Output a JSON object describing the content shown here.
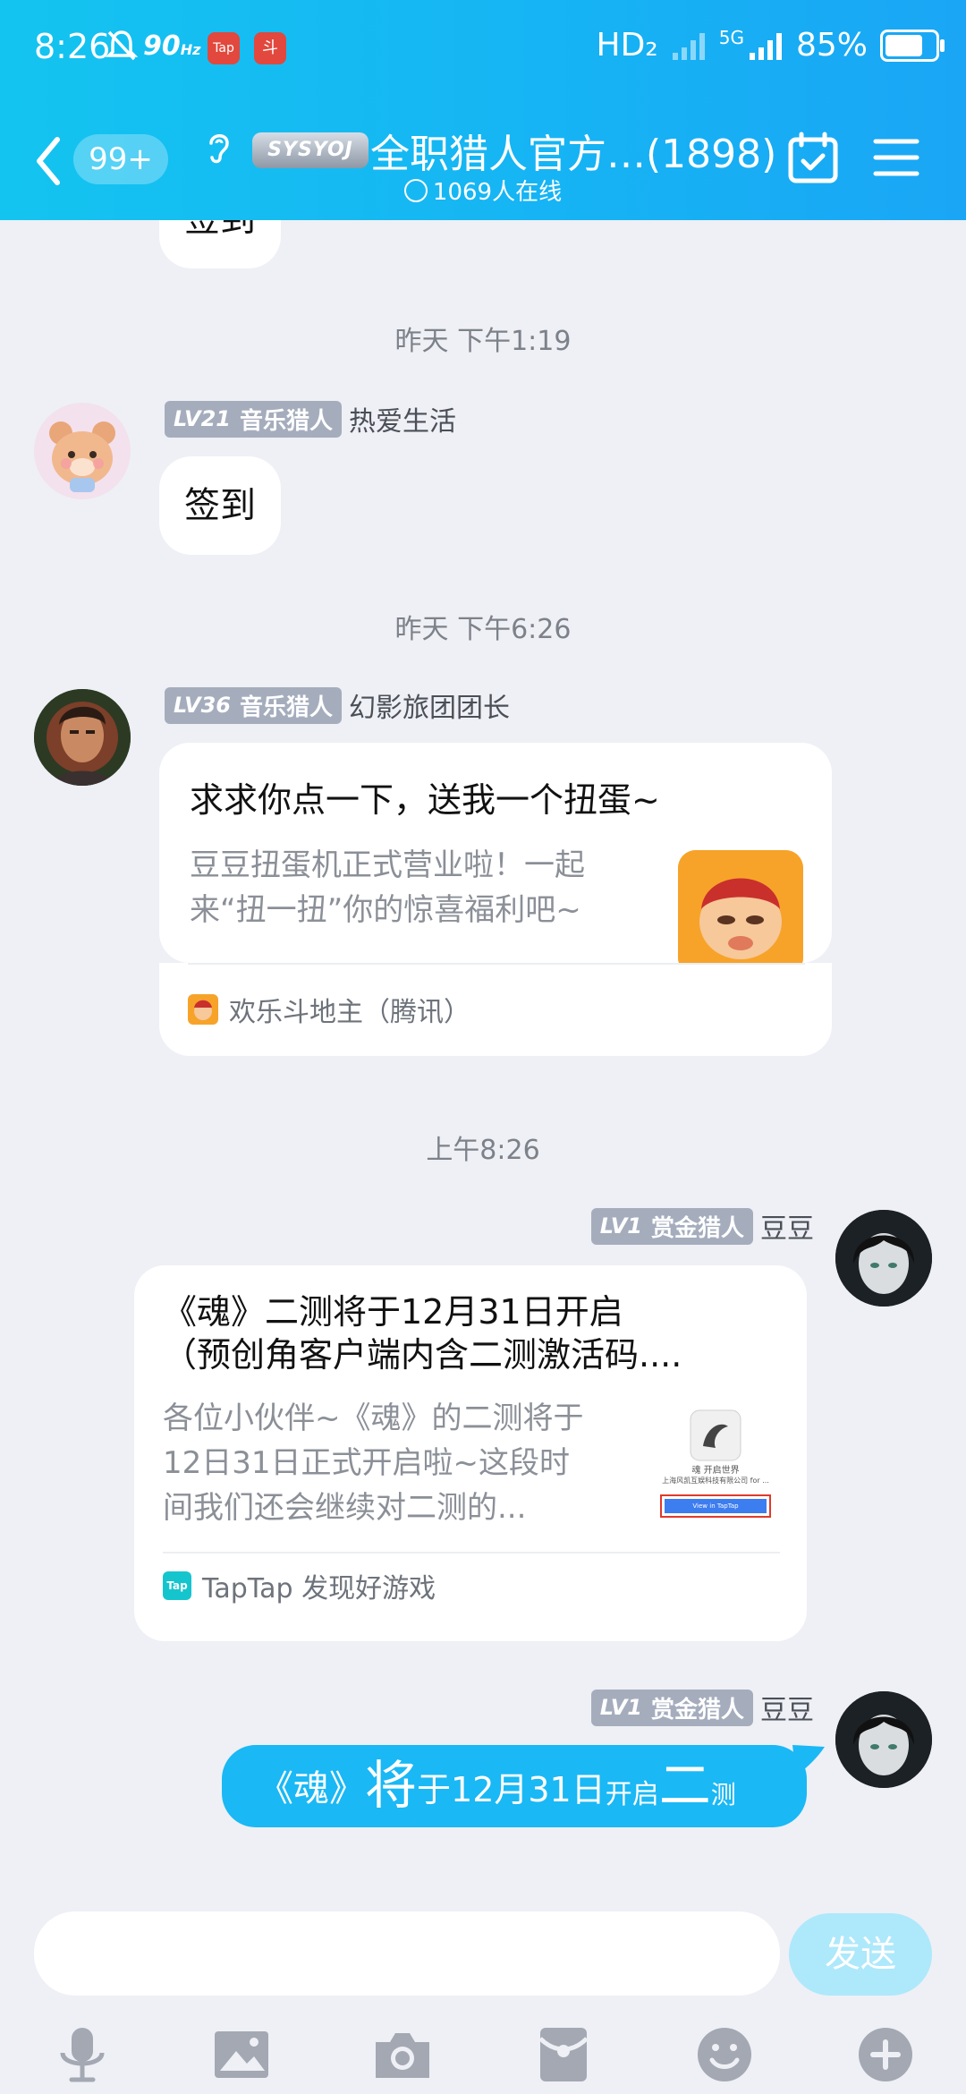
{
  "status_bar": {
    "time": "8:26",
    "refresh_rate": "90",
    "refresh_rate_unit": "Hz",
    "app_badges": [
      "Tap",
      "斗"
    ],
    "network": "HD₂",
    "network_sub": "5G",
    "battery_text": "85%",
    "battery_level": 0.85
  },
  "header": {
    "unread_count": "99+",
    "group_logo_text": "SYSYOJ",
    "group_name": "全职猎人官方…(1898)",
    "online_text": "1069人在线"
  },
  "chat": {
    "partial_message": "签到",
    "timestamp_1": "昨天 下午1:19",
    "msg1": {
      "level": "LV21",
      "rank": "音乐猎人",
      "title": "热爱生活",
      "text": "签到"
    },
    "timestamp_2": "昨天 下午6:26",
    "msg2": {
      "level": "LV36",
      "rank": "音乐猎人",
      "title": "幻影旅团团长",
      "card_title": "求求你点一下，送我一个扭蛋~",
      "card_desc_1": "豆豆扭蛋机正式营业啦！一起",
      "card_desc_2": "来“扭一扭”你的惊喜福利吧~",
      "card_source": "欢乐斗地主（腾讯）"
    },
    "timestamp_3": "上午8:26",
    "msg3": {
      "level": "LV1",
      "rank": "赏金猎人",
      "name": "豆豆",
      "card_title_1": "《魂》二测将于12月31日开启",
      "card_title_2": "（预创角客户端内含二测激活码....",
      "card_desc_1": "各位小伙伴~《魂》的二测将于",
      "card_desc_2": "12日31日正式开启啦~这段时",
      "card_desc_3": "间我们还会继续对二测的...",
      "thumb_caption": "魂 开启世界",
      "thumb_company": "上海风凯互娱科技有限公司 for ...",
      "thumb_button": "View in TapTap",
      "card_source": "TapTap 发现好游戏",
      "source_icon": "Tap"
    },
    "msg4": {
      "level": "LV1",
      "rank": "赏金猎人",
      "name": "豆豆",
      "segments": [
        "《魂》",
        "将",
        "于12月31日",
        "开启",
        "二",
        "测"
      ]
    }
  },
  "input": {
    "placeholder": "",
    "send_label": "发送"
  },
  "toolbar": [
    "microphone-icon",
    "image-icon",
    "camera-icon",
    "red-packet-icon",
    "emoji-icon",
    "plus-icon"
  ],
  "colors": {
    "header": "#16b3f4",
    "bubble_self": "#1ab8f5",
    "badge": "#a5adbd",
    "send_disabled": "#aee8fb"
  }
}
